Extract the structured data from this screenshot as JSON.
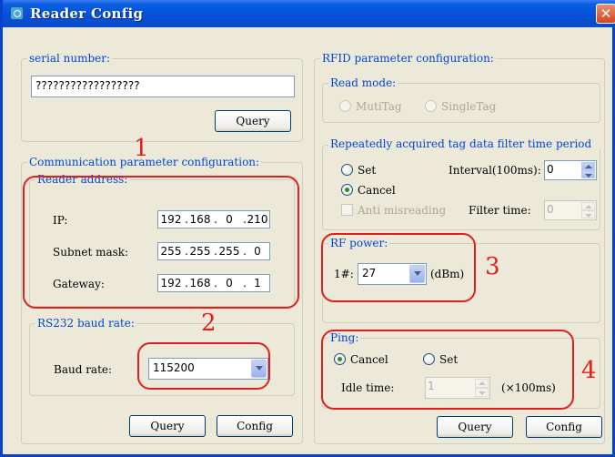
{
  "window": {
    "title": "Reader Config",
    "close_glyph": "✕"
  },
  "serial": {
    "legend": "serial number:",
    "value": "??????????????????",
    "query_label": "Query"
  },
  "comm": {
    "legend": "Communication parameter configuration:",
    "reader_address": {
      "legend": "Reader address:",
      "ip_label": "IP:",
      "ip": [
        "192",
        "168",
        "0",
        "210"
      ],
      "subnet_label": "Subnet mask:",
      "subnet": [
        "255",
        "255",
        "255",
        "0"
      ],
      "gateway_label": "Gateway:",
      "gateway": [
        "192",
        "168",
        "0",
        "1"
      ]
    },
    "rs232": {
      "legend": "RS232 baud rate:",
      "baud_label": "Baud rate:",
      "baud_value": "115200"
    },
    "query_label": "Query",
    "config_label": "Config"
  },
  "rfid": {
    "legend": "RFID parameter configuration:",
    "read_mode": {
      "legend": "Read mode:",
      "options": [
        "MutiTag",
        "SingleTag"
      ]
    },
    "filter": {
      "legend": "Repeatedly acquired tag data filter time period",
      "set_label": "Set",
      "cancel_label": "Cancel",
      "interval_label": "Interval(100ms):",
      "interval_value": "0",
      "anti_label": "Anti misreading",
      "filter_time_label": "Filter time:",
      "filter_time_value": "0"
    },
    "rf_power": {
      "legend": "RF power:",
      "channel_label": "1#:",
      "value": "27",
      "unit": "(dBm)"
    },
    "ping": {
      "legend": "Ping:",
      "cancel_label": "Cancel",
      "set_label": "Set",
      "idle_label": "Idle time:",
      "idle_value": "1",
      "idle_unit": "(×100ms)"
    },
    "query_label": "Query",
    "config_label": "Config"
  },
  "annotations": [
    "1",
    "2",
    "3",
    "4"
  ],
  "colors": {
    "accent": "#0046d5",
    "annotation": "#e0201e",
    "titlebar": "#0550d8",
    "window_bg": "#ece9d8"
  }
}
